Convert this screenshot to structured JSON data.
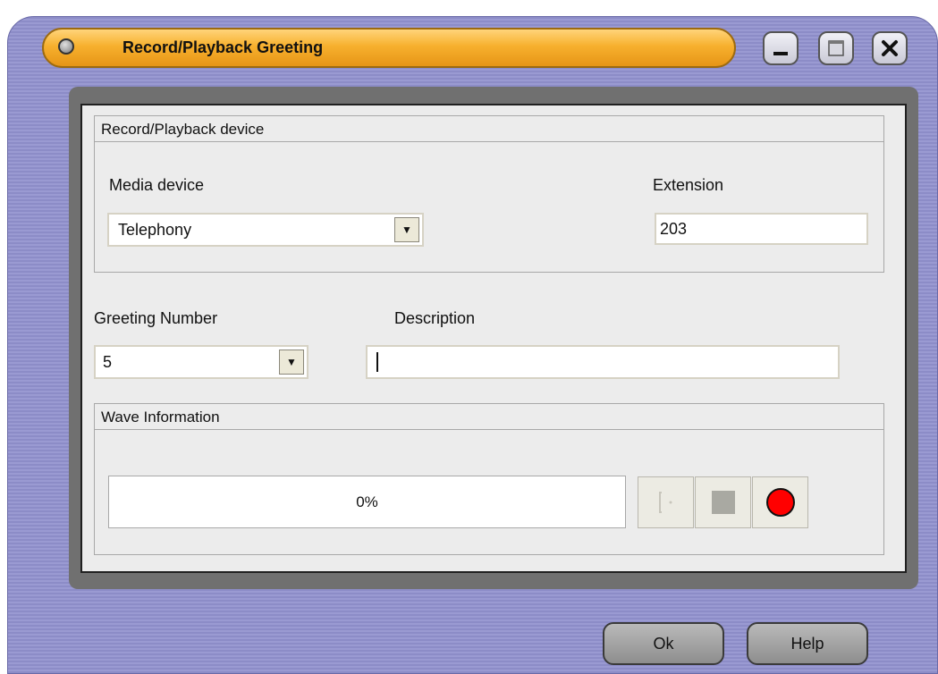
{
  "window": {
    "title": "Record/Playback Greeting",
    "controls": {
      "minimize_icon": "minimize-icon",
      "maximize_icon": "maximize-icon",
      "close_icon": "close-icon"
    }
  },
  "device_group": {
    "header": "Record/Playback device",
    "media_device_label": "Media device",
    "media_device_value": "Telephony",
    "extension_label": "Extension",
    "extension_value": "203"
  },
  "greeting": {
    "number_label": "Greeting Number",
    "number_value": "5",
    "description_label": "Description",
    "description_value": ""
  },
  "wave_group": {
    "header": "Wave Information",
    "progress_text": "0%",
    "progress_value": 0,
    "buttons": {
      "play_icon": "play-icon",
      "stop_icon": "stop-icon",
      "record_icon": "record-icon"
    }
  },
  "footer": {
    "ok_label": "Ok",
    "help_label": "Help"
  },
  "colors": {
    "title_bar": "#f7b02e",
    "frame": "#9a9ad2",
    "record": "#ff0000"
  }
}
